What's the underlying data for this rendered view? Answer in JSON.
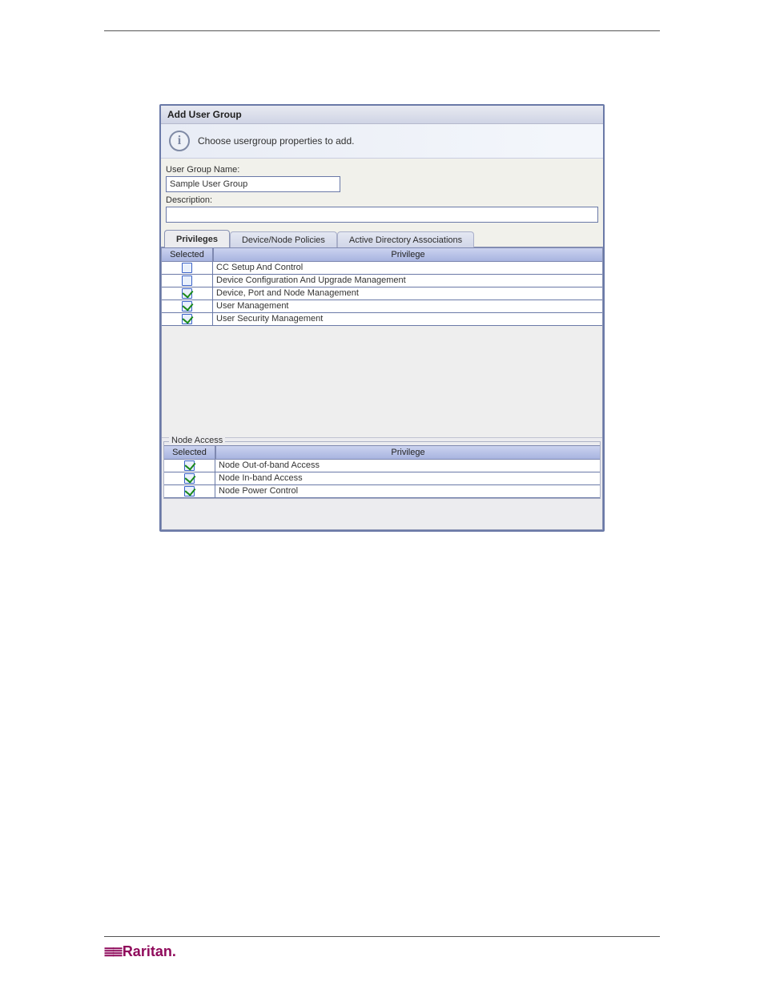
{
  "dialog": {
    "title": "Add User Group",
    "banner": "Choose usergroup properties to add.",
    "labels": {
      "group_name": "User Group Name:",
      "description": "Description:"
    },
    "fields": {
      "group_name_value": "Sample User Group",
      "description_value": ""
    },
    "tabs": [
      {
        "label": "Privileges",
        "active": true
      },
      {
        "label": "Device/Node Policies",
        "active": false
      },
      {
        "label": "Active Directory Associations",
        "active": false
      }
    ],
    "priv_table": {
      "head_selected": "Selected",
      "head_privilege": "Privilege",
      "rows": [
        {
          "checked": false,
          "label": "CC Setup And Control"
        },
        {
          "checked": false,
          "label": "Device Configuration And Upgrade Management"
        },
        {
          "checked": true,
          "label": "Device, Port and Node Management"
        },
        {
          "checked": true,
          "label": "User Management"
        },
        {
          "checked": true,
          "label": "User Security Management"
        }
      ]
    },
    "node_access": {
      "legend": "Node Access",
      "head_selected": "Selected",
      "head_privilege": "Privilege",
      "rows": [
        {
          "checked": true,
          "label": "Node Out-of-band Access"
        },
        {
          "checked": true,
          "label": "Node In-band Access"
        },
        {
          "checked": true,
          "label": "Node Power Control"
        }
      ]
    }
  },
  "footer": {
    "brand": "Raritan."
  }
}
